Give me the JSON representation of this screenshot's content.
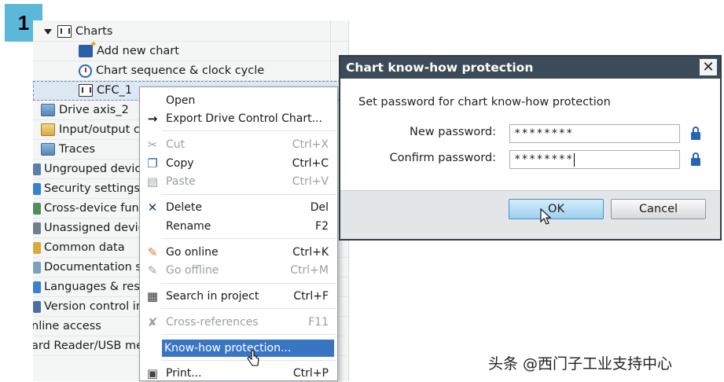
{
  "step_badge": "1",
  "tree": {
    "items": [
      {
        "label": "Charts"
      },
      {
        "label": "Add new chart"
      },
      {
        "label": "Chart sequence & clock cycle"
      },
      {
        "label": "CFC_1"
      },
      {
        "label": "Drive axis_2"
      },
      {
        "label": "Input/output c"
      },
      {
        "label": "Traces"
      },
      {
        "label": "Ungrouped devic"
      },
      {
        "label": "Security settings"
      },
      {
        "label": "Cross-device func"
      },
      {
        "label": "Unassigned devic"
      },
      {
        "label": "Common data"
      },
      {
        "label": "Documentation s"
      },
      {
        "label": "Languages & res"
      },
      {
        "label": "Version control ir"
      },
      {
        "label": "nline access"
      },
      {
        "label": "ard Reader/USB me"
      }
    ]
  },
  "context_menu": {
    "items": [
      {
        "label": "Open",
        "shortcut": "",
        "icon": "none",
        "disabled": false
      },
      {
        "label": "Export Drive Control Chart...",
        "shortcut": "",
        "icon": "export-arrow-icon",
        "disabled": false
      },
      {
        "label": "Cut",
        "shortcut": "Ctrl+X",
        "icon": "scissors-icon",
        "disabled": true
      },
      {
        "label": "Copy",
        "shortcut": "Ctrl+C",
        "icon": "copy-icon",
        "disabled": false
      },
      {
        "label": "Paste",
        "shortcut": "Ctrl+V",
        "icon": "paste-icon",
        "disabled": true
      },
      {
        "label": "Delete",
        "shortcut": "Del",
        "icon": "x-icon",
        "disabled": false
      },
      {
        "label": "Rename",
        "shortcut": "F2",
        "icon": "none",
        "disabled": false
      },
      {
        "label": "Go online",
        "shortcut": "Ctrl+K",
        "icon": "go-online-icon",
        "disabled": false
      },
      {
        "label": "Go offline",
        "shortcut": "Ctrl+M",
        "icon": "go-offline-icon",
        "disabled": true
      },
      {
        "label": "Search in project",
        "shortcut": "Ctrl+F",
        "icon": "search-icon",
        "disabled": false
      },
      {
        "label": "Cross-references",
        "shortcut": "F11",
        "icon": "cross-reference-icon",
        "disabled": true
      },
      {
        "label": "Know-how protection...",
        "shortcut": "",
        "icon": "none",
        "disabled": false,
        "highlighted": true
      },
      {
        "label": "Print...",
        "shortcut": "Ctrl+P",
        "icon": "print-icon",
        "disabled": false
      }
    ]
  },
  "dialog": {
    "title": "Chart know-how protection",
    "close_glyph": "✕",
    "description": "Set password for chart know-how protection",
    "new_password_label": "New password:",
    "new_password_value": "********",
    "confirm_password_label": "Confirm password:",
    "confirm_password_value": "********",
    "ok_label": "OK",
    "cancel_label": "Cancel"
  },
  "watermark": "头条 @西门子工业支持中心",
  "colors": {
    "badge": "#5bb8d9",
    "dialog_title_bar": "#3c4b57",
    "menu_highlight": "#3a75c4",
    "lock": "#2764b5"
  }
}
